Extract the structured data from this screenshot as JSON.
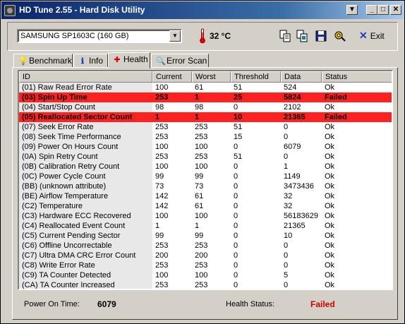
{
  "window": {
    "title": "HD Tune 2.55 - Hard Disk Utility",
    "controls": [
      "▼",
      "_",
      "□",
      "✕"
    ]
  },
  "toolbar": {
    "drive_value": "SAMSUNG SP1603C (160 GB)",
    "temperature": "32 °C",
    "exit_label": "Exit",
    "icons": [
      "copy-info-icon",
      "copy-screenshot-icon",
      "save-icon",
      "options-icon"
    ]
  },
  "tabs": [
    {
      "label": "Benchmark",
      "icon": "benchmark-icon",
      "glyph": "💡"
    },
    {
      "label": "Info",
      "icon": "info-icon",
      "glyph": "ℹ"
    },
    {
      "label": "Health",
      "icon": "health-icon",
      "glyph": "✚"
    },
    {
      "label": "Error Scan",
      "icon": "error-scan-icon",
      "glyph": "🔍"
    }
  ],
  "table": {
    "columns": [
      "ID",
      "Current",
      "Worst",
      "Threshold",
      "Data",
      "Status"
    ],
    "rows": [
      {
        "id": "(01) Raw Read Error Rate",
        "current": "100",
        "worst": "61",
        "threshold": "51",
        "data": "524",
        "status": "Ok",
        "failed": false
      },
      {
        "id": "(03) Spin Up Time",
        "current": "253",
        "worst": "1",
        "threshold": "25",
        "data": "5824",
        "status": "Failed",
        "failed": true
      },
      {
        "id": "(04) Start/Stop Count",
        "current": "98",
        "worst": "98",
        "threshold": "0",
        "data": "2102",
        "status": "Ok",
        "failed": false
      },
      {
        "id": "(05) Reallocated Sector Count",
        "current": "1",
        "worst": "1",
        "threshold": "10",
        "data": "21365",
        "status": "Failed",
        "failed": true
      },
      {
        "id": "(07) Seek Error Rate",
        "current": "253",
        "worst": "253",
        "threshold": "51",
        "data": "0",
        "status": "Ok",
        "failed": false
      },
      {
        "id": "(08) Seek Time Performance",
        "current": "253",
        "worst": "253",
        "threshold": "15",
        "data": "0",
        "status": "Ok",
        "failed": false
      },
      {
        "id": "(09) Power On Hours Count",
        "current": "100",
        "worst": "100",
        "threshold": "0",
        "data": "6079",
        "status": "Ok",
        "failed": false
      },
      {
        "id": "(0A) Spin Retry Count",
        "current": "253",
        "worst": "253",
        "threshold": "51",
        "data": "0",
        "status": "Ok",
        "failed": false
      },
      {
        "id": "(0B) Calibration Retry Count",
        "current": "100",
        "worst": "100",
        "threshold": "0",
        "data": "1",
        "status": "Ok",
        "failed": false
      },
      {
        "id": "(0C) Power Cycle Count",
        "current": "99",
        "worst": "99",
        "threshold": "0",
        "data": "1149",
        "status": "Ok",
        "failed": false
      },
      {
        "id": "(BB) (unknown attribute)",
        "current": "73",
        "worst": "73",
        "threshold": "0",
        "data": "3473436",
        "status": "Ok",
        "failed": false
      },
      {
        "id": "(BE) Airflow Temperature",
        "current": "142",
        "worst": "61",
        "threshold": "0",
        "data": "32",
        "status": "Ok",
        "failed": false
      },
      {
        "id": "(C2) Temperature",
        "current": "142",
        "worst": "61",
        "threshold": "0",
        "data": "32",
        "status": "Ok",
        "failed": false
      },
      {
        "id": "(C3) Hardware ECC Recovered",
        "current": "100",
        "worst": "100",
        "threshold": "0",
        "data": "56183629",
        "status": "Ok",
        "failed": false
      },
      {
        "id": "(C4) Reallocated Event Count",
        "current": "1",
        "worst": "1",
        "threshold": "0",
        "data": "21365",
        "status": "Ok",
        "failed": false
      },
      {
        "id": "(C5) Current Pending Sector",
        "current": "99",
        "worst": "99",
        "threshold": "0",
        "data": "10",
        "status": "Ok",
        "failed": false
      },
      {
        "id": "(C6) Offline Uncorrectable",
        "current": "253",
        "worst": "253",
        "threshold": "0",
        "data": "0",
        "status": "Ok",
        "failed": false
      },
      {
        "id": "(C7) Ultra DMA CRC Error Count",
        "current": "200",
        "worst": "200",
        "threshold": "0",
        "data": "0",
        "status": "Ok",
        "failed": false
      },
      {
        "id": "(C8) Write Error Rate",
        "current": "253",
        "worst": "253",
        "threshold": "0",
        "data": "0",
        "status": "Ok",
        "failed": false
      },
      {
        "id": "(C9) TA Counter Detected",
        "current": "100",
        "worst": "100",
        "threshold": "0",
        "data": "5",
        "status": "Ok",
        "failed": false
      },
      {
        "id": "(CA) TA Counter Increased",
        "current": "253",
        "worst": "253",
        "threshold": "0",
        "data": "0",
        "status": "Ok",
        "failed": false
      }
    ]
  },
  "footer": {
    "power_on_label": "Power On Time:",
    "power_on_value": "6079",
    "health_label": "Health Status:",
    "health_value": "Failed"
  },
  "colors": {
    "failed_row": "#ff2020",
    "failed_text": "#cc0000",
    "titlebar": "#0a246a"
  }
}
